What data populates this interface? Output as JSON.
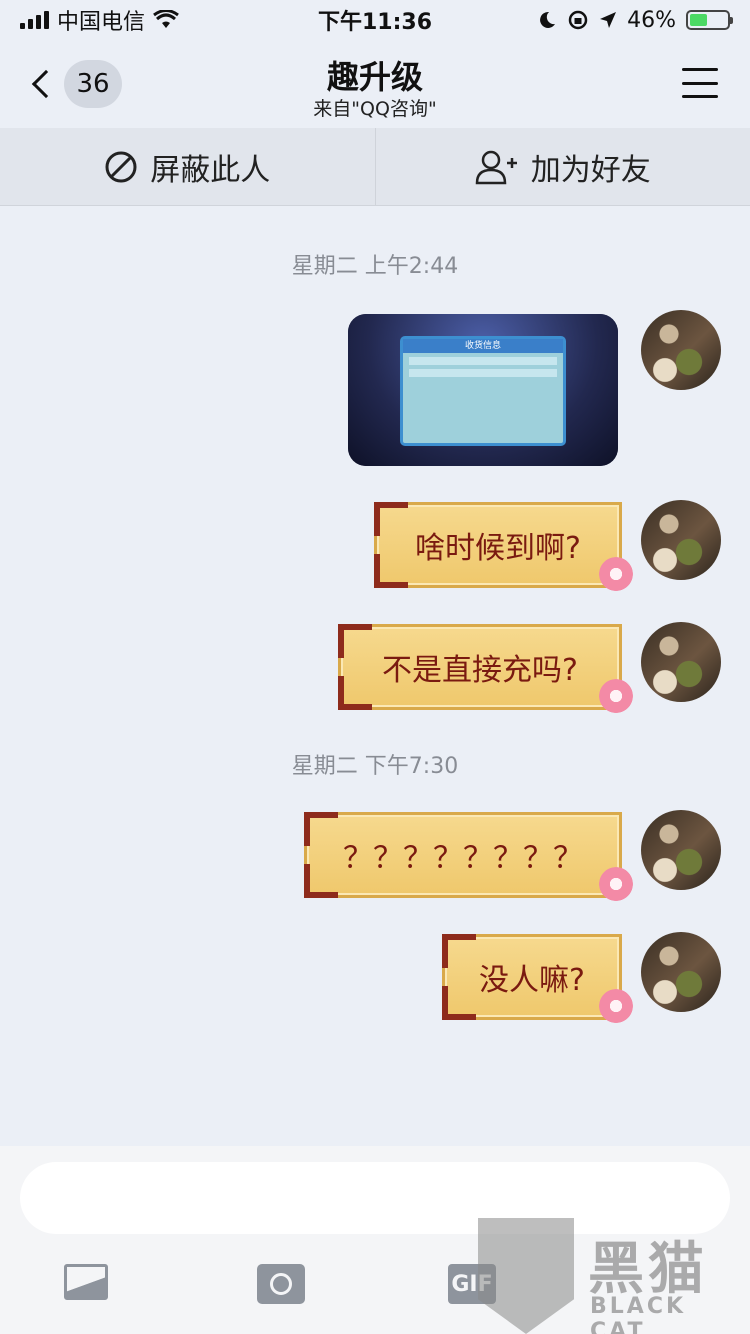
{
  "status_bar": {
    "carrier": "中国电信",
    "time": "下午11:36",
    "battery_percent": "46%",
    "battery_level": 0.46
  },
  "nav": {
    "back_count": "36",
    "title": "趣升级",
    "subtitle": "来自\"QQ咨询\""
  },
  "actions": {
    "block_label": "屏蔽此人",
    "add_friend_label": "加为好友"
  },
  "chat": {
    "timestamps": [
      "星期二 上午2:44",
      "星期二 下午7:30"
    ],
    "image_dialog_title": "收货信息",
    "messages": [
      {
        "text": "啥时候到啊?"
      },
      {
        "text": "不是直接充吗?"
      },
      {
        "text": "？？？？？？？？"
      },
      {
        "text": "没人嘛?"
      }
    ]
  },
  "input": {
    "placeholder": "",
    "gif_label": "GIF"
  },
  "watermark": {
    "title": "黑猫",
    "subtitle": "BLACK CAT"
  },
  "icons": [
    "signal-icon",
    "wifi-icon",
    "moon-icon",
    "rotation-lock-icon",
    "location-icon",
    "battery-icon",
    "chevron-left-icon",
    "menu-icon",
    "block-icon",
    "add-friend-icon",
    "image-icon",
    "camera-icon",
    "gif-icon"
  ]
}
